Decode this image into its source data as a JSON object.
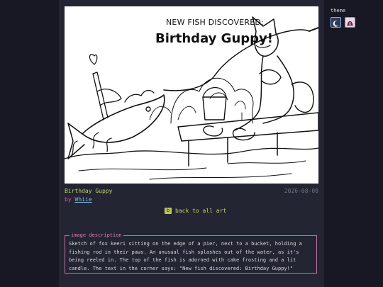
{
  "artwork": {
    "heading_small": "NEW FISH DISCOVERED:",
    "heading_big": "Birthday Guppy!"
  },
  "art": {
    "title": "Birthday Guppy",
    "date": "2026-08-08",
    "by_prefix": "by",
    "author": "Whiie"
  },
  "nav": {
    "back_label": "back to all art",
    "back_icon": "b"
  },
  "description": {
    "legend": "image description",
    "text": "Sketch of fox keeri sitting on the edge of a pier, next to a bucket, holding a fishing rod in their paws. An unusual fish splashes out of the water, as it's being reeled in. The top of the fish is adorned with cake frosting and a lit candle. The text in the corner says: \"New fish discovered: Birthday Guppy!\""
  },
  "theme": {
    "label": "theme",
    "options": [
      "dark-moon-icon",
      "light-shell-icon"
    ]
  },
  "colors": {
    "background": "#171823",
    "panel": "#232533",
    "accent_green": "#c4d16b",
    "accent_pink": "#d05aa4",
    "link_blue": "#7fb7e0"
  }
}
